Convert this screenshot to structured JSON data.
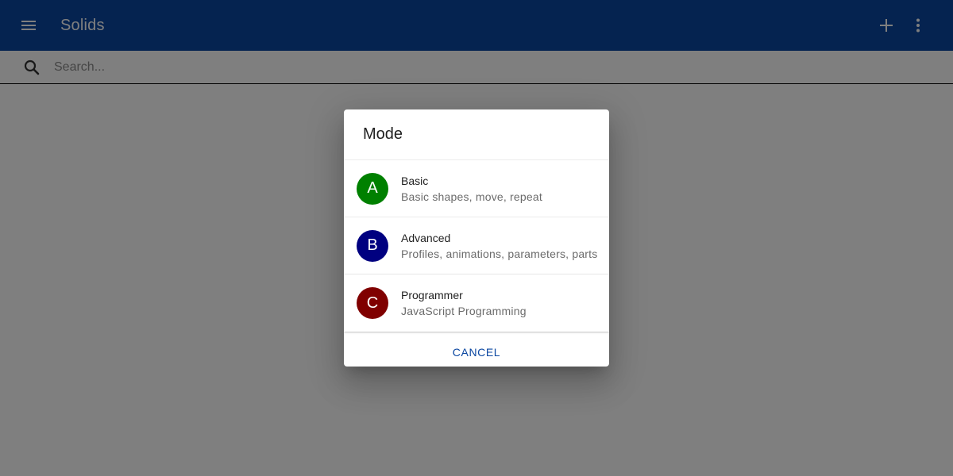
{
  "appbar": {
    "title": "Solids",
    "menu_icon": "hamburger-menu-icon",
    "add_icon": "plus-icon",
    "more_icon": "vertical-dots-icon",
    "color": "#0b47a1"
  },
  "search": {
    "placeholder": "Search...",
    "value": "",
    "icon": "search-icon"
  },
  "dialog": {
    "title": "Mode",
    "options": [
      {
        "letter": "A",
        "label": "Basic",
        "description": "Basic shapes, move, repeat",
        "color": "#008000"
      },
      {
        "letter": "B",
        "label": "Advanced",
        "description": "Profiles, animations, parameters, parts",
        "color": "#000080"
      },
      {
        "letter": "C",
        "label": "Programmer",
        "description": "JavaScript Programming",
        "color": "#800000"
      }
    ],
    "cancel_label": "CANCEL",
    "accent_color": "#0b47a1"
  }
}
